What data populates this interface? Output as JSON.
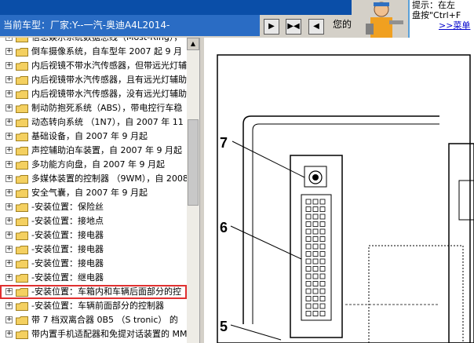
{
  "header": {
    "car_label": "当前车型：",
    "car_value": "厂家:Y--一汽-奥迪A4L2014-",
    "your_label": "您的",
    "tip_line1": "提示：在左",
    "tip_line2": "盘按\"Ctrl+F",
    "tip_link": ">>菜单"
  },
  "tree": {
    "items": [
      {
        "label": "信息娱乐系统数据总线（Most-Ring），"
      },
      {
        "label": "倒车摄像系统，自车型年 2007 起 9 月"
      },
      {
        "label": "内后视镜不带水汽传感器，但带远光灯辅"
      },
      {
        "label": "内后视镜带水汽传感器，且有远光灯辅助"
      },
      {
        "label": "内后视镜带水汽传感器，没有远光灯辅助"
      },
      {
        "label": "制动防抱死系统（ABS），带电控行车稳"
      },
      {
        "label": "动态转向系统 （1N7），自 2007 年 11"
      },
      {
        "label": "基础设备，自 2007 年 9 月起"
      },
      {
        "label": "声控辅助泊车装置，自 2007 年 9 月起"
      },
      {
        "label": "多功能方向盘，自 2007 年 9 月起"
      },
      {
        "label": "多媒体装置的控制器 （9WM），自 2008"
      },
      {
        "label": "安全气囊，自 2007 年 9 月起"
      },
      {
        "label": "-安装位置：保险丝"
      },
      {
        "label": "-安装位置：接地点"
      },
      {
        "label": "-安装位置：接电器"
      },
      {
        "label": "-安装位置：接电器"
      },
      {
        "label": "-安装位置：接电器"
      },
      {
        "label": "-安装位置：继电器"
      },
      {
        "label": "-安装位置：车箱内和车辆后面部分的控"
      },
      {
        "label": "-安装位置：车辆前面部分的控制器"
      },
      {
        "label": "带 7 档双离合器 0B5 （S tronic） 的"
      },
      {
        "label": "带内置手机适配器和免提对话装置的 MM"
      },
      {
        "label": "带内置手机适配器和免提对话装置的 MM"
      }
    ],
    "selected_index": 18
  },
  "diagram": {
    "callouts": [
      "7",
      "6",
      "5"
    ]
  }
}
